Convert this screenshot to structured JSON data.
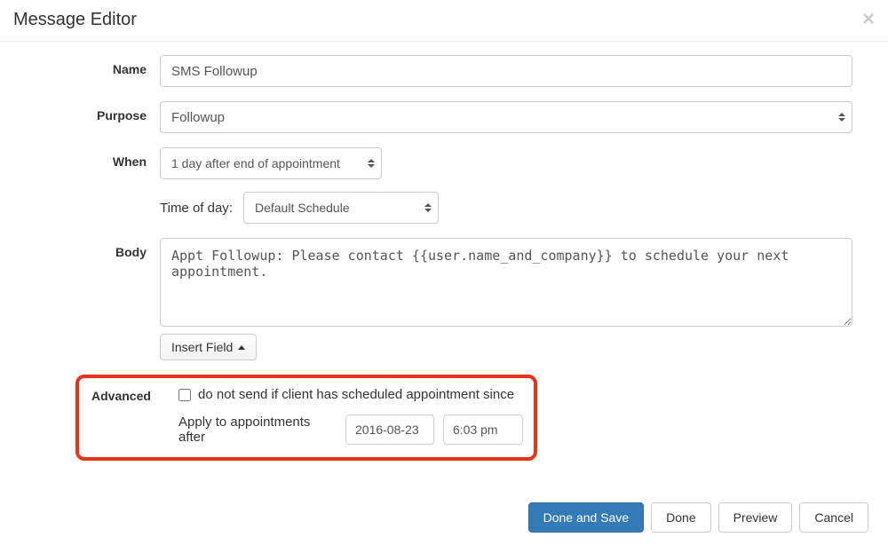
{
  "header": {
    "title": "Message Editor"
  },
  "labels": {
    "name": "Name",
    "purpose": "Purpose",
    "when": "When",
    "time_of_day": "Time of day:",
    "body": "Body",
    "advanced": "Advanced",
    "insert_field": "Insert Field",
    "do_not_send": "do not send if client has scheduled appointment since",
    "apply_after": "Apply to appointments after"
  },
  "fields": {
    "name_value": "SMS Followup",
    "purpose_value": "Followup",
    "when_value": "1 day after end of appointment",
    "tod_value": "Default Schedule",
    "body_value": "Appt Followup: Please contact {{user.name_and_company}} to schedule your next appointment.",
    "do_not_send_checked": false,
    "apply_date": "2016-08-23",
    "apply_time": "6:03 pm"
  },
  "buttons": {
    "done_save": "Done and Save",
    "done": "Done",
    "preview": "Preview",
    "cancel": "Cancel"
  }
}
